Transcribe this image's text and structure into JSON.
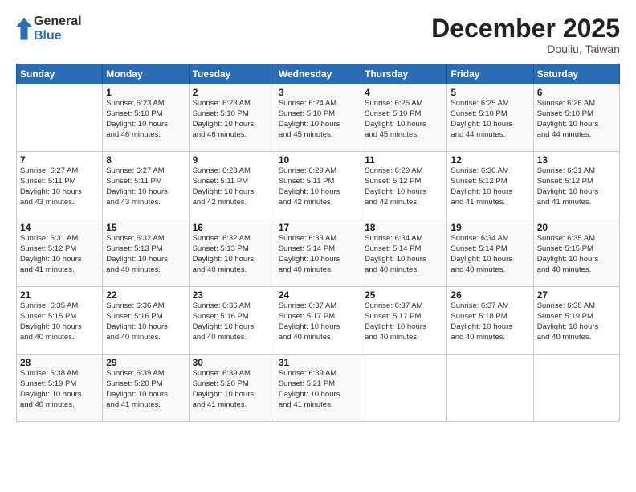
{
  "logo": {
    "general": "General",
    "blue": "Blue"
  },
  "header": {
    "month": "December 2025",
    "location": "Douliu, Taiwan"
  },
  "weekdays": [
    "Sunday",
    "Monday",
    "Tuesday",
    "Wednesday",
    "Thursday",
    "Friday",
    "Saturday"
  ],
  "weeks": [
    [
      {
        "day": "",
        "info": ""
      },
      {
        "day": "1",
        "info": "Sunrise: 6:23 AM\nSunset: 5:10 PM\nDaylight: 10 hours\nand 46 minutes."
      },
      {
        "day": "2",
        "info": "Sunrise: 6:23 AM\nSunset: 5:10 PM\nDaylight: 10 hours\nand 46 minutes."
      },
      {
        "day": "3",
        "info": "Sunrise: 6:24 AM\nSunset: 5:10 PM\nDaylight: 10 hours\nand 45 minutes."
      },
      {
        "day": "4",
        "info": "Sunrise: 6:25 AM\nSunset: 5:10 PM\nDaylight: 10 hours\nand 45 minutes."
      },
      {
        "day": "5",
        "info": "Sunrise: 6:25 AM\nSunset: 5:10 PM\nDaylight: 10 hours\nand 44 minutes."
      },
      {
        "day": "6",
        "info": "Sunrise: 6:26 AM\nSunset: 5:10 PM\nDaylight: 10 hours\nand 44 minutes."
      }
    ],
    [
      {
        "day": "7",
        "info": "Sunrise: 6:27 AM\nSunset: 5:11 PM\nDaylight: 10 hours\nand 43 minutes."
      },
      {
        "day": "8",
        "info": "Sunrise: 6:27 AM\nSunset: 5:11 PM\nDaylight: 10 hours\nand 43 minutes."
      },
      {
        "day": "9",
        "info": "Sunrise: 6:28 AM\nSunset: 5:11 PM\nDaylight: 10 hours\nand 42 minutes."
      },
      {
        "day": "10",
        "info": "Sunrise: 6:29 AM\nSunset: 5:11 PM\nDaylight: 10 hours\nand 42 minutes."
      },
      {
        "day": "11",
        "info": "Sunrise: 6:29 AM\nSunset: 5:12 PM\nDaylight: 10 hours\nand 42 minutes."
      },
      {
        "day": "12",
        "info": "Sunrise: 6:30 AM\nSunset: 5:12 PM\nDaylight: 10 hours\nand 41 minutes."
      },
      {
        "day": "13",
        "info": "Sunrise: 6:31 AM\nSunset: 5:12 PM\nDaylight: 10 hours\nand 41 minutes."
      }
    ],
    [
      {
        "day": "14",
        "info": "Sunrise: 6:31 AM\nSunset: 5:12 PM\nDaylight: 10 hours\nand 41 minutes."
      },
      {
        "day": "15",
        "info": "Sunrise: 6:32 AM\nSunset: 5:13 PM\nDaylight: 10 hours\nand 40 minutes."
      },
      {
        "day": "16",
        "info": "Sunrise: 6:32 AM\nSunset: 5:13 PM\nDaylight: 10 hours\nand 40 minutes."
      },
      {
        "day": "17",
        "info": "Sunrise: 6:33 AM\nSunset: 5:14 PM\nDaylight: 10 hours\nand 40 minutes."
      },
      {
        "day": "18",
        "info": "Sunrise: 6:34 AM\nSunset: 5:14 PM\nDaylight: 10 hours\nand 40 minutes."
      },
      {
        "day": "19",
        "info": "Sunrise: 6:34 AM\nSunset: 5:14 PM\nDaylight: 10 hours\nand 40 minutes."
      },
      {
        "day": "20",
        "info": "Sunrise: 6:35 AM\nSunset: 5:15 PM\nDaylight: 10 hours\nand 40 minutes."
      }
    ],
    [
      {
        "day": "21",
        "info": "Sunrise: 6:35 AM\nSunset: 5:15 PM\nDaylight: 10 hours\nand 40 minutes."
      },
      {
        "day": "22",
        "info": "Sunrise: 6:36 AM\nSunset: 5:16 PM\nDaylight: 10 hours\nand 40 minutes."
      },
      {
        "day": "23",
        "info": "Sunrise: 6:36 AM\nSunset: 5:16 PM\nDaylight: 10 hours\nand 40 minutes."
      },
      {
        "day": "24",
        "info": "Sunrise: 6:37 AM\nSunset: 5:17 PM\nDaylight: 10 hours\nand 40 minutes."
      },
      {
        "day": "25",
        "info": "Sunrise: 6:37 AM\nSunset: 5:17 PM\nDaylight: 10 hours\nand 40 minutes."
      },
      {
        "day": "26",
        "info": "Sunrise: 6:37 AM\nSunset: 5:18 PM\nDaylight: 10 hours\nand 40 minutes."
      },
      {
        "day": "27",
        "info": "Sunrise: 6:38 AM\nSunset: 5:19 PM\nDaylight: 10 hours\nand 40 minutes."
      }
    ],
    [
      {
        "day": "28",
        "info": "Sunrise: 6:38 AM\nSunset: 5:19 PM\nDaylight: 10 hours\nand 40 minutes."
      },
      {
        "day": "29",
        "info": "Sunrise: 6:39 AM\nSunset: 5:20 PM\nDaylight: 10 hours\nand 41 minutes."
      },
      {
        "day": "30",
        "info": "Sunrise: 6:39 AM\nSunset: 5:20 PM\nDaylight: 10 hours\nand 41 minutes."
      },
      {
        "day": "31",
        "info": "Sunrise: 6:39 AM\nSunset: 5:21 PM\nDaylight: 10 hours\nand 41 minutes."
      },
      {
        "day": "",
        "info": ""
      },
      {
        "day": "",
        "info": ""
      },
      {
        "day": "",
        "info": ""
      }
    ]
  ]
}
